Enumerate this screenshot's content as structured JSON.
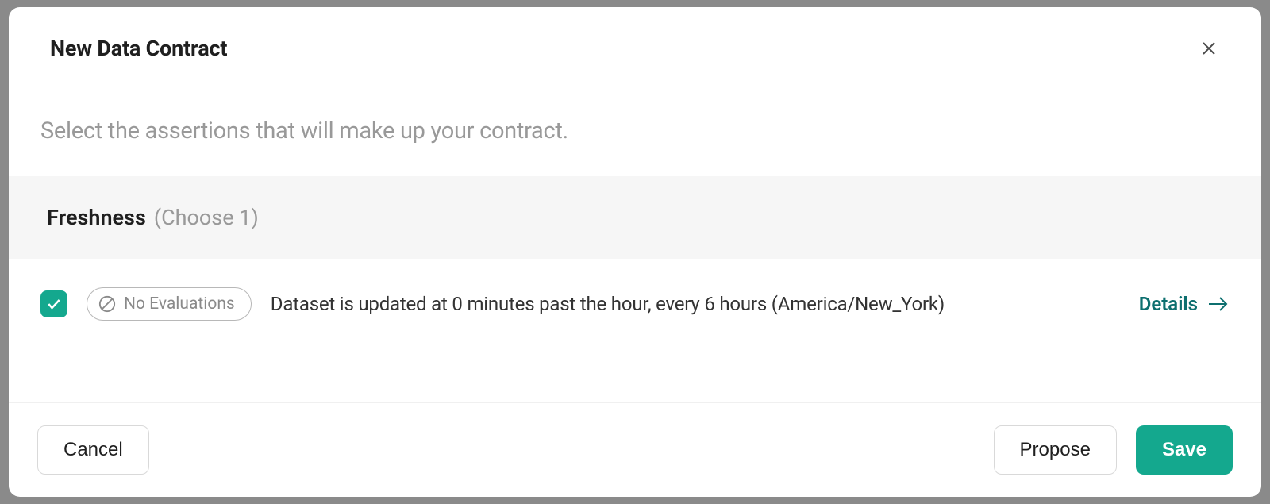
{
  "modal": {
    "title": "New Data Contract",
    "description": "Select the assertions that will make up your contract."
  },
  "section": {
    "title": "Freshness",
    "hint": "(Choose 1)"
  },
  "assertion": {
    "badge_label": "No Evaluations",
    "text": "Dataset is updated at 0 minutes past the hour, every 6 hours (America/New_York)",
    "details_label": "Details"
  },
  "footer": {
    "cancel_label": "Cancel",
    "propose_label": "Propose",
    "save_label": "Save"
  },
  "colors": {
    "accent": "#14a88e",
    "accent_dark": "#0d6f6f"
  }
}
